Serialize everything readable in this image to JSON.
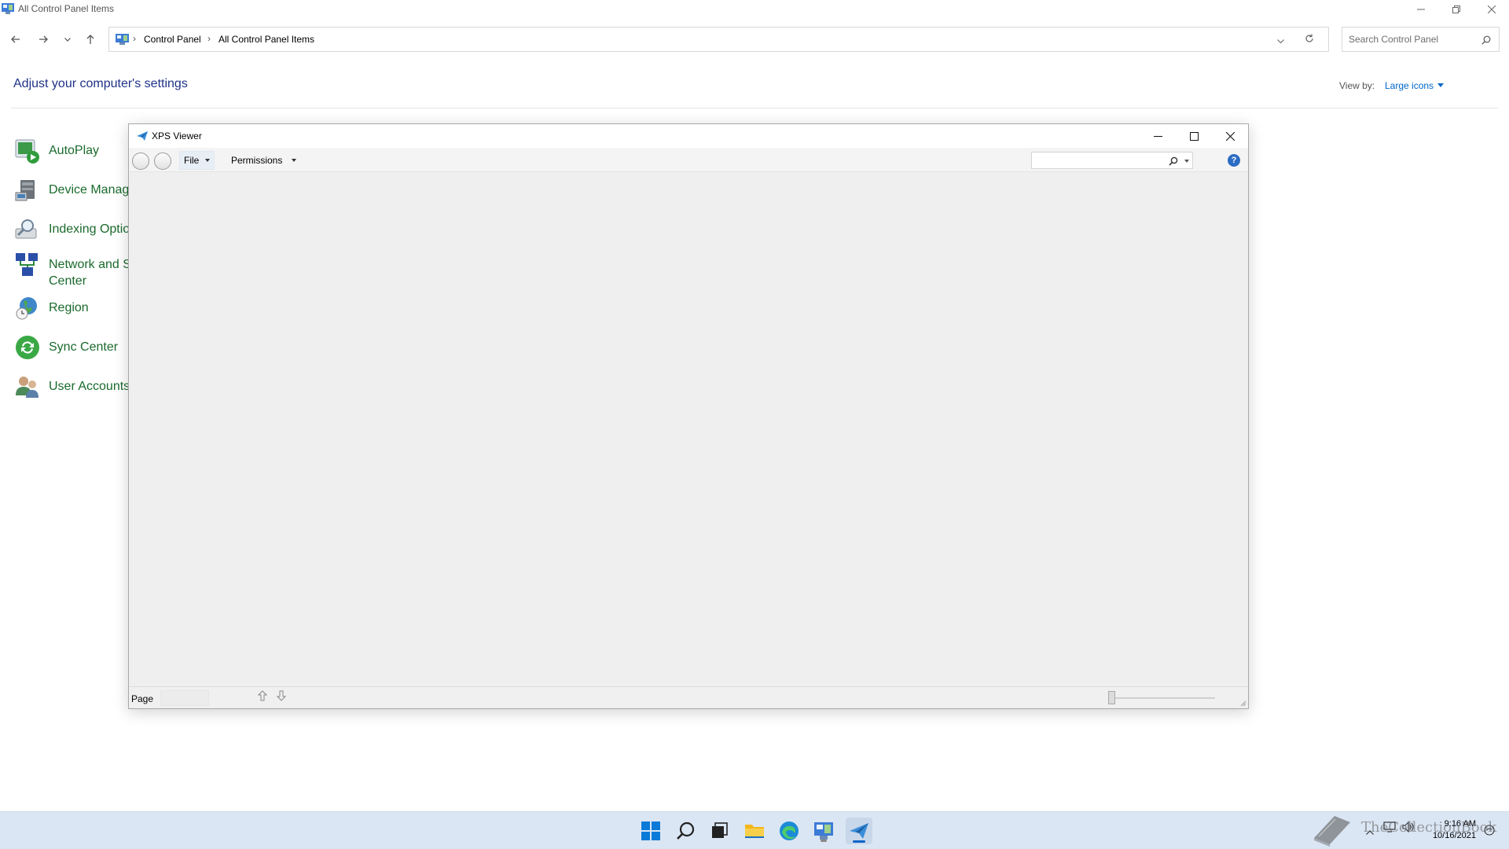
{
  "control_panel": {
    "window_title": "All Control Panel Items",
    "breadcrumb": [
      "Control Panel",
      "All Control Panel Items"
    ],
    "search_placeholder": "Search Control Panel",
    "heading": "Adjust your computer's settings",
    "view_by_label": "View by:",
    "view_by_value": "Large icons",
    "items": [
      {
        "label": "AutoPlay",
        "icon": "autoplay-icon"
      },
      {
        "label": "Device Manage",
        "icon": "device-manager-icon"
      },
      {
        "label": "Indexing Optio",
        "icon": "indexing-options-icon"
      },
      {
        "label": "Network and S",
        "label2": "Center",
        "icon": "network-icon"
      },
      {
        "label": "Region",
        "icon": "region-globe-icon"
      },
      {
        "label": "Sync Center",
        "icon": "sync-center-icon"
      },
      {
        "label": "User Accounts",
        "icon": "user-accounts-icon"
      }
    ]
  },
  "xps_viewer": {
    "title": "XPS Viewer",
    "menu": {
      "file": "File",
      "permissions": "Permissions"
    },
    "status": {
      "page_label": "Page"
    },
    "help_glyph": "?"
  },
  "taskbar": {
    "icons": [
      "start-icon",
      "search-icon",
      "task-view-icon",
      "file-explorer-icon",
      "edge-icon",
      "control-panel-icon",
      "xps-viewer-icon"
    ],
    "clock": {
      "time": "9:16 AM",
      "date": "10/16/2021"
    }
  },
  "watermark": {
    "text": "TheCollectionBook"
  },
  "colors": {
    "link_green": "#1a6a2c",
    "heading_blue": "#1e3287",
    "accent": "#0a64c8",
    "taskbar_bg": "#dbe6f4"
  }
}
